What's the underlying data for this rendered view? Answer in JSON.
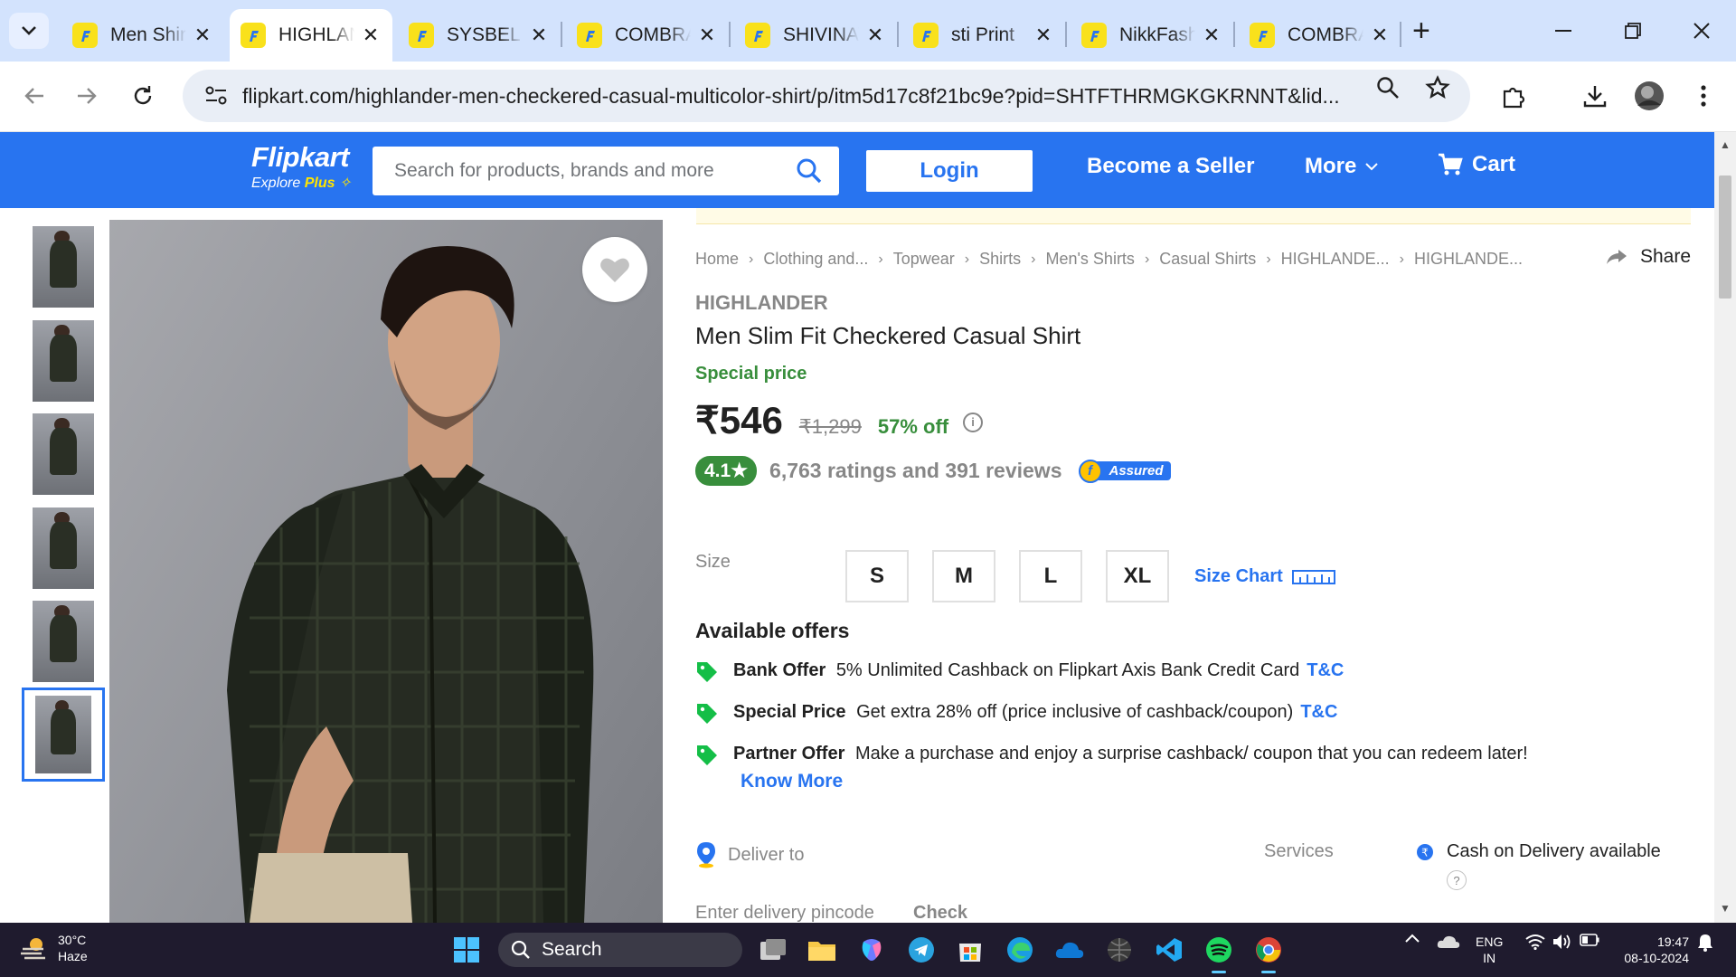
{
  "browser": {
    "tabs": [
      {
        "title": "Men Shirts",
        "active": false
      },
      {
        "title": "HIGHLANDER",
        "active": true
      },
      {
        "title": "SYSBEL",
        "active": false
      },
      {
        "title": "COMBRAIDED",
        "active": false
      },
      {
        "title": "SHIVINAY",
        "active": false
      },
      {
        "title": "sti Print",
        "active": false
      },
      {
        "title": "NikkFashion",
        "active": false
      },
      {
        "title": "COMBRAIDED",
        "active": false
      }
    ],
    "url": "flipkart.com/highlander-men-checkered-casual-multicolor-shirt/p/itm5d17c8f21bc9e?pid=SHTFTHRMGKGKRNNT&lid..."
  },
  "header": {
    "logo": "Flipkart",
    "logo_sub": "Explore",
    "logo_plus": "Plus",
    "search_placeholder": "Search for products, brands and more",
    "login": "Login",
    "seller": "Become a Seller",
    "more": "More",
    "cart": "Cart"
  },
  "breadcrumb": [
    "Home",
    "Clothing and...",
    "Topwear",
    "Shirts",
    "Men's Shirts",
    "Casual Shirts",
    "HIGHLANDE...",
    "HIGHLANDE..."
  ],
  "share": "Share",
  "product": {
    "brand": "HIGHLANDER",
    "title": "Men Slim Fit Checkered Casual Shirt",
    "special": "Special price",
    "price": "₹546",
    "mrp": "₹1,299",
    "discount": "57% off",
    "rating": "4.1★",
    "reviews": "6,763 ratings and 391 reviews",
    "assured": "Assured",
    "colors": {
      "accent": "#2874f0",
      "green": "#388e3c"
    }
  },
  "size": {
    "label": "Size",
    "options": [
      "S",
      "M",
      "L",
      "XL"
    ],
    "chart": "Size Chart"
  },
  "offers": {
    "title": "Available offers",
    "items": [
      {
        "type": "Bank Offer",
        "text": "5% Unlimited Cashback on Flipkart Axis Bank Credit Card",
        "link": "T&C"
      },
      {
        "type": "Special Price",
        "text": "Get extra 28% off (price inclusive of cashback/coupon)",
        "link": "T&C"
      },
      {
        "type": "Partner Offer",
        "text": "Make a purchase and enjoy a surprise cashback/ coupon that you can redeem later!",
        "link": ""
      }
    ],
    "know_more": "Know More"
  },
  "delivery": {
    "label": "Deliver to",
    "pincode_placeholder": "Enter delivery pincode",
    "check": "Check",
    "services": "Services",
    "cod": "Cash on Delivery available",
    "cod_help": "?"
  },
  "taskbar": {
    "temp": "30°C",
    "weather": "Haze",
    "search": "Search",
    "lang1": "ENG",
    "lang2": "IN",
    "time": "19:47",
    "date": "08-10-2024"
  }
}
